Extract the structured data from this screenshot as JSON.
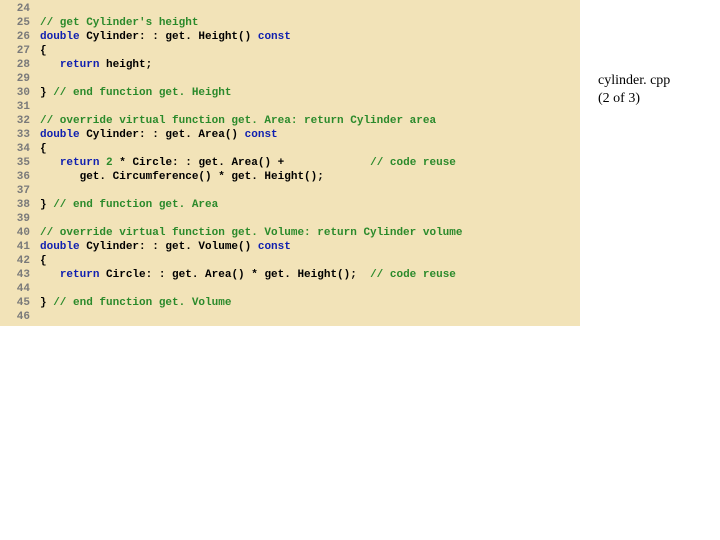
{
  "annotation": {
    "filename": "cylinder. cpp",
    "page": "(2 of 3)"
  },
  "lines": [
    {
      "n": "24",
      "tokens": []
    },
    {
      "n": "25",
      "tokens": [
        {
          "t": "comment",
          "s": "// get Cylinder's height"
        }
      ]
    },
    {
      "n": "26",
      "tokens": [
        {
          "t": "keyword",
          "s": "double"
        },
        {
          "t": "plain",
          "s": " Cylinder: : get. Height() "
        },
        {
          "t": "keyword",
          "s": "const"
        }
      ]
    },
    {
      "n": "27",
      "tokens": [
        {
          "t": "plain",
          "s": "{"
        }
      ]
    },
    {
      "n": "28",
      "tokens": [
        {
          "t": "plain",
          "s": "   "
        },
        {
          "t": "keyword",
          "s": "return"
        },
        {
          "t": "plain",
          "s": " height;"
        }
      ]
    },
    {
      "n": "29",
      "tokens": []
    },
    {
      "n": "30",
      "tokens": [
        {
          "t": "plain",
          "s": "} "
        },
        {
          "t": "comment",
          "s": "// end function get. Height"
        }
      ]
    },
    {
      "n": "31",
      "tokens": []
    },
    {
      "n": "32",
      "tokens": [
        {
          "t": "comment",
          "s": "// override virtual function get. Area: return Cylinder area"
        }
      ]
    },
    {
      "n": "33",
      "tokens": [
        {
          "t": "keyword",
          "s": "double"
        },
        {
          "t": "plain",
          "s": " Cylinder: : get. Area() "
        },
        {
          "t": "keyword",
          "s": "const"
        }
      ]
    },
    {
      "n": "34",
      "tokens": [
        {
          "t": "plain",
          "s": "{"
        }
      ]
    },
    {
      "n": "35",
      "tokens": [
        {
          "t": "plain",
          "s": "   "
        },
        {
          "t": "keyword",
          "s": "return"
        },
        {
          "t": "plain",
          "s": " "
        },
        {
          "t": "number",
          "s": "2"
        },
        {
          "t": "plain",
          "s": " * Circle: : get. Area() +             "
        },
        {
          "t": "comment",
          "s": "// code reuse"
        }
      ]
    },
    {
      "n": "36",
      "tokens": [
        {
          "t": "plain",
          "s": "      get. Circumference() * get. Height();"
        }
      ]
    },
    {
      "n": "37",
      "tokens": []
    },
    {
      "n": "38",
      "tokens": [
        {
          "t": "plain",
          "s": "} "
        },
        {
          "t": "comment",
          "s": "// end function get. Area"
        }
      ]
    },
    {
      "n": "39",
      "tokens": []
    },
    {
      "n": "40",
      "tokens": [
        {
          "t": "comment",
          "s": "// override virtual function get. Volume: return Cylinder volume"
        }
      ]
    },
    {
      "n": "41",
      "tokens": [
        {
          "t": "keyword",
          "s": "double"
        },
        {
          "t": "plain",
          "s": " Cylinder: : get. Volume() "
        },
        {
          "t": "keyword",
          "s": "const"
        }
      ]
    },
    {
      "n": "42",
      "tokens": [
        {
          "t": "plain",
          "s": "{"
        }
      ]
    },
    {
      "n": "43",
      "tokens": [
        {
          "t": "plain",
          "s": "   "
        },
        {
          "t": "keyword",
          "s": "return"
        },
        {
          "t": "plain",
          "s": " Circle: : get. Area() * get. Height();  "
        },
        {
          "t": "comment",
          "s": "// code reuse"
        }
      ]
    },
    {
      "n": "44",
      "tokens": []
    },
    {
      "n": "45",
      "tokens": [
        {
          "t": "plain",
          "s": "} "
        },
        {
          "t": "comment",
          "s": "// end function get. Volume"
        }
      ]
    },
    {
      "n": "46",
      "tokens": []
    }
  ]
}
